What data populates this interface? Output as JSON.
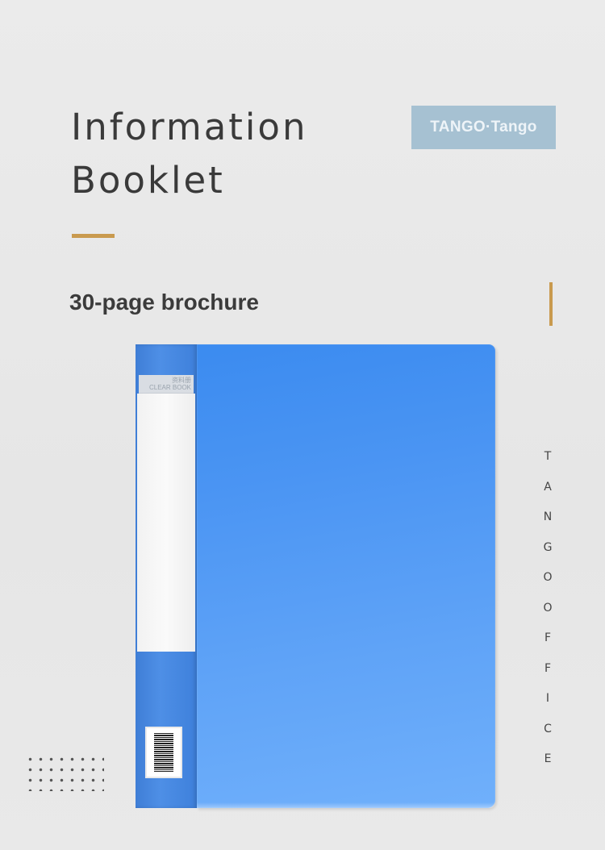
{
  "heading": {
    "line1": "Information",
    "line2": "Booklet"
  },
  "brand_badge": "TANGO·Tango",
  "subtitle": "30-page brochure",
  "vertical_text": [
    "T",
    "A",
    "N",
    "G",
    "O",
    " ",
    "O",
    "F",
    "F",
    "I",
    "C",
    "E"
  ],
  "folder": {
    "spine_label_cn": "资料册",
    "spine_label_en": "CLEAR BOOK",
    "color": "#4a90e8"
  },
  "colors": {
    "accent": "#c99a4e",
    "background": "#e8e8e8",
    "badge": "#a6c1d2"
  }
}
